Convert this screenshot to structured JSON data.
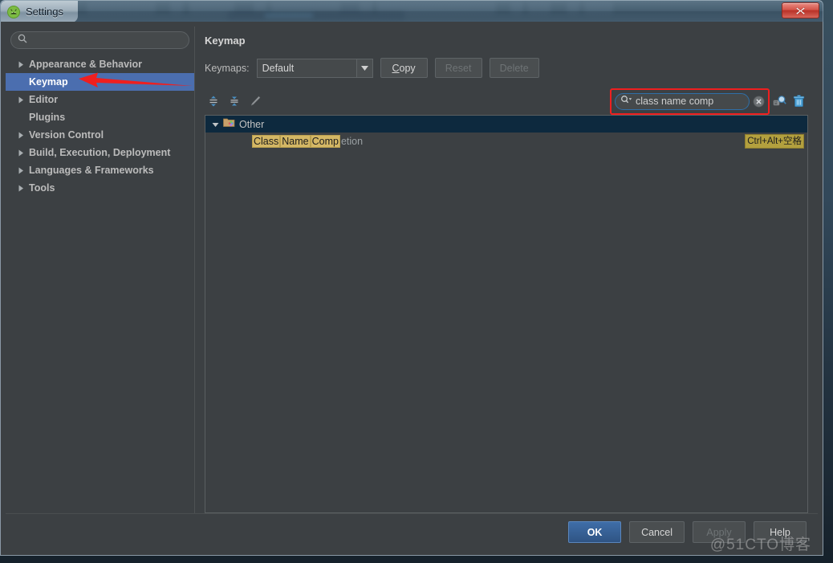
{
  "window": {
    "title": "Settings",
    "app_icon": "android-studio-icon",
    "close_label": "x"
  },
  "sidebar": {
    "search": {
      "placeholder": "",
      "value": "",
      "icon": "search-icon"
    },
    "items": [
      {
        "label": "Appearance & Behavior",
        "expandable": true,
        "selected": false
      },
      {
        "label": "Keymap",
        "expandable": false,
        "selected": true
      },
      {
        "label": "Editor",
        "expandable": true,
        "selected": false
      },
      {
        "label": "Plugins",
        "expandable": false,
        "selected": false
      },
      {
        "label": "Version Control",
        "expandable": true,
        "selected": false
      },
      {
        "label": "Build, Execution, Deployment",
        "expandable": true,
        "selected": false
      },
      {
        "label": "Languages & Frameworks",
        "expandable": true,
        "selected": false
      },
      {
        "label": "Tools",
        "expandable": true,
        "selected": false
      }
    ]
  },
  "main": {
    "title": "Keymap",
    "keymaps_label": "Keymaps:",
    "keymap_selected": "Default",
    "buttons": {
      "copy": "Copy",
      "copy_mnemonic": "C",
      "copy_rest": "opy",
      "reset": "Reset",
      "delete": "Delete"
    },
    "toolbar_icons": [
      {
        "name": "expand-all-icon"
      },
      {
        "name": "collapse-all-icon"
      },
      {
        "name": "edit-shortcut-icon"
      }
    ],
    "search": {
      "value": "class name comp",
      "icon": "search-dropdown-icon",
      "clear_icon": "clear-icon"
    },
    "right_icons": [
      {
        "name": "find-by-shortcut-icon"
      },
      {
        "name": "delete-filter-icon"
      }
    ],
    "tree": {
      "group": {
        "label": "Other",
        "icon": "folder-icon",
        "expanded": true
      },
      "action": {
        "highlighted_parts": [
          "Class",
          "Name",
          "Comp"
        ],
        "plain_tail": "etion",
        "shortcut": "Ctrl+Alt+空格"
      }
    }
  },
  "footer": {
    "ok": "OK",
    "cancel": "Cancel",
    "apply": "Apply",
    "help": "Help",
    "watermark": "@51CTO博客"
  },
  "colors": {
    "accent_blue": "#4b6eaf",
    "panel_bg": "#3c4043",
    "selection_row": "#0d293e",
    "highlight_yellow": "#d4b765",
    "annotation_red": "#ef1f1f"
  }
}
